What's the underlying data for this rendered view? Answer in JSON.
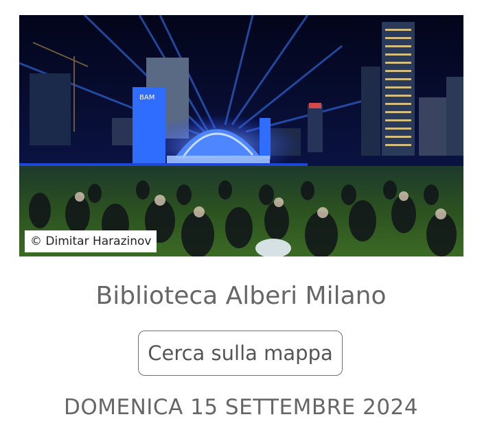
{
  "event_image": {
    "alt": "Concerto serale all'aperto alla Biblioteca degli Alberi",
    "credit": "© Dimitar Harazinov",
    "stage_sign": "BAM"
  },
  "venue": {
    "name": "Biblioteca Alberi Milano"
  },
  "map_button": {
    "label": "Cerca sulla mappa"
  },
  "event_date": {
    "label": "DOMENICA 15 SETTEMBRE 2024"
  },
  "colors": {
    "text_gray": "#666666",
    "button_border": "#6f6f6f",
    "night_sky": "#070a22",
    "stage_blue": "#2a6cff",
    "lawn_green": "#2f5a1c"
  }
}
